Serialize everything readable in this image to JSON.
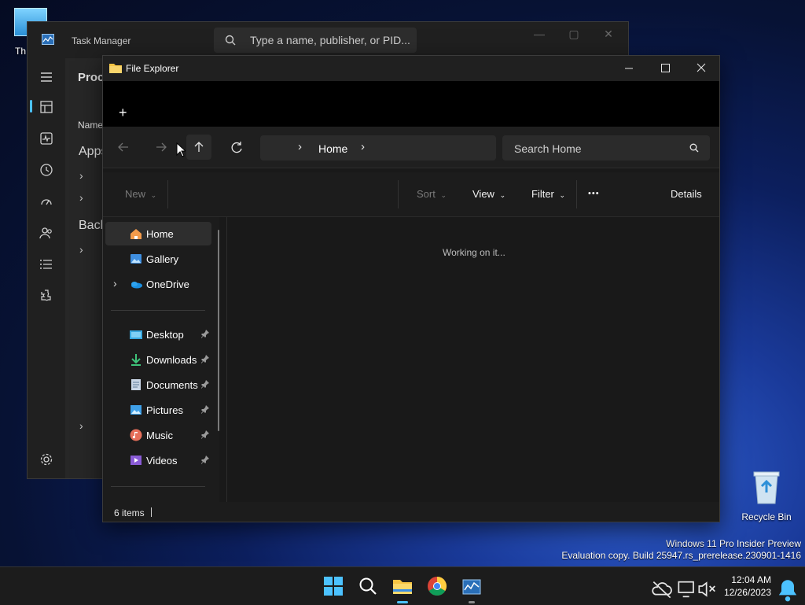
{
  "desktop": {
    "partial_icon_label": "Th",
    "recycle_bin_label": "Recycle Bin",
    "watermark_line1": "Windows 11 Pro Insider Preview",
    "watermark_line2": "Evaluation copy. Build 25947.rs_prerelease.230901-1416"
  },
  "task_manager": {
    "title": "Task Manager",
    "search_placeholder": "Type a name, publisher, or PID...",
    "heading_partial": "Proce",
    "column_name_partial": "Name",
    "group_apps_partial": "Apps",
    "group_background_partial": "Back"
  },
  "explorer": {
    "title": "File Explorer",
    "new_tab_symbol": "+",
    "address": {
      "location": "Home"
    },
    "search_placeholder": "Search Home",
    "commands": {
      "new": "New",
      "sort": "Sort",
      "view": "View",
      "filter": "Filter",
      "more": "•••",
      "details": "Details"
    },
    "nav_items": [
      {
        "label": "Home",
        "icon": "home-icon"
      },
      {
        "label": "Gallery",
        "icon": "gallery-icon"
      },
      {
        "label": "OneDrive",
        "icon": "onedrive-icon"
      },
      {
        "label": "Desktop",
        "icon": "desktop-folder-icon"
      },
      {
        "label": "Downloads",
        "icon": "downloads-icon"
      },
      {
        "label": "Documents",
        "icon": "documents-icon"
      },
      {
        "label": "Pictures",
        "icon": "pictures-icon"
      },
      {
        "label": "Music",
        "icon": "music-icon"
      },
      {
        "label": "Videos",
        "icon": "videos-icon"
      }
    ],
    "content_message": "Working on it...",
    "status_items": "6 items"
  },
  "taskbar": {
    "time": "12:04 AM",
    "date": "12/26/2023"
  },
  "colors": {
    "accent": "#4cc2ff",
    "folder": "#f6c443",
    "window_bg": "#191919"
  }
}
